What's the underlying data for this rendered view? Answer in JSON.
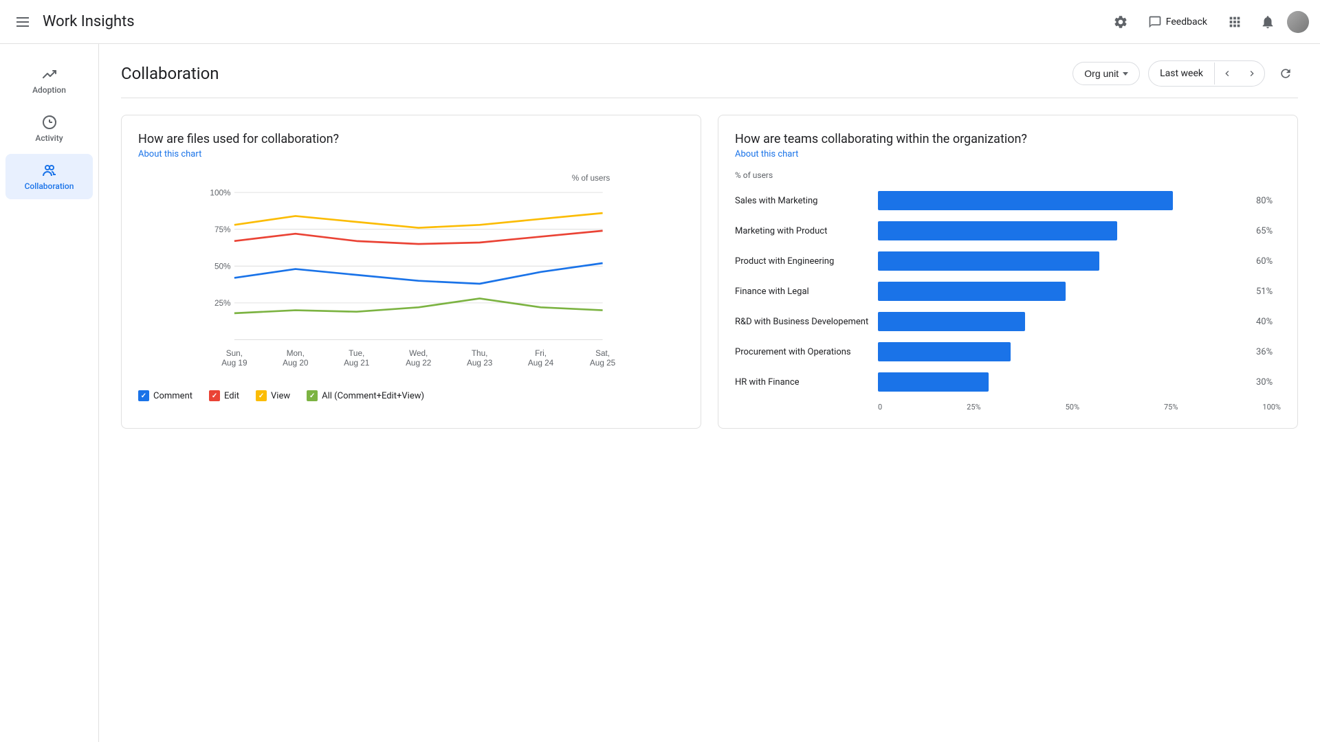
{
  "header": {
    "menu_icon": "hamburger-icon",
    "title": "Work Insights",
    "feedback_label": "Feedback",
    "settings_icon": "gear-icon",
    "feedback_icon": "feedback-icon",
    "apps_icon": "apps-icon",
    "notifications_icon": "bell-icon",
    "avatar_icon": "avatar-icon"
  },
  "sidebar": {
    "items": [
      {
        "id": "adoption",
        "label": "Adoption",
        "icon": "trending-up-icon",
        "active": false
      },
      {
        "id": "activity",
        "label": "Activity",
        "icon": "activity-icon",
        "active": false
      },
      {
        "id": "collaboration",
        "label": "Collaboration",
        "icon": "collaboration-icon",
        "active": true
      }
    ]
  },
  "page": {
    "title": "Collaboration",
    "org_unit_label": "Org unit",
    "date_label": "Last week",
    "about_chart_label": "About this chart"
  },
  "left_chart": {
    "title": "How are files used for collaboration?",
    "about_label": "About this chart",
    "y_axis_label": "% of users",
    "y_ticks": [
      "100%",
      "75%",
      "50%",
      "25%",
      ""
    ],
    "x_labels": [
      {
        "line1": "Sun,",
        "line2": "Aug 19"
      },
      {
        "line1": "Mon,",
        "line2": "Aug 20"
      },
      {
        "line1": "Tue,",
        "line2": "Aug 21"
      },
      {
        "line1": "Wed,",
        "line2": "Aug 22"
      },
      {
        "line1": "Thu,",
        "line2": "Aug 23"
      },
      {
        "line1": "Fri,",
        "line2": "Aug 24"
      },
      {
        "line1": "Sat,",
        "line2": "Aug 25"
      }
    ],
    "legend": [
      {
        "label": "Comment",
        "color": "#1a73e8"
      },
      {
        "label": "Edit",
        "color": "#ea4335"
      },
      {
        "label": "View",
        "color": "#fbbc04"
      },
      {
        "label": "All (Comment+Edit+View)",
        "color": "#7cb342"
      }
    ],
    "series": {
      "comment": [
        42,
        48,
        44,
        40,
        38,
        46,
        52
      ],
      "edit": [
        68,
        72,
        68,
        65,
        66,
        70,
        74
      ],
      "view": [
        78,
        84,
        80,
        76,
        78,
        82,
        86
      ],
      "all": [
        18,
        20,
        19,
        22,
        28,
        22,
        20
      ]
    }
  },
  "right_chart": {
    "title": "How are teams collaborating within the organization?",
    "about_label": "About this chart",
    "y_axis_label": "% of users",
    "bars": [
      {
        "label": "Sales with Marketing",
        "value": 80,
        "display": "80%"
      },
      {
        "label": "Marketing with Product",
        "value": 65,
        "display": "65%"
      },
      {
        "label": "Product with Engineering",
        "value": 60,
        "display": "60%"
      },
      {
        "label": "Finance with Legal",
        "value": 51,
        "display": "51%"
      },
      {
        "label": "R&D with Business Developement",
        "value": 40,
        "display": "40%"
      },
      {
        "label": "Procurement with Operations",
        "value": 36,
        "display": "36%"
      },
      {
        "label": "HR with Finance",
        "value": 30,
        "display": "30%"
      }
    ],
    "x_ticks": [
      "0",
      "25%",
      "50%",
      "75%",
      "100%"
    ]
  }
}
